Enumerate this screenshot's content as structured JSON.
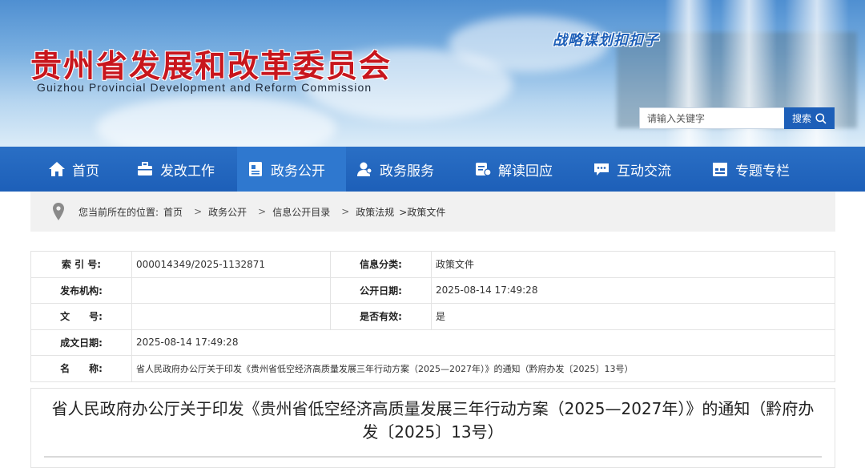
{
  "header": {
    "title_cn": "贵州省发展和改革委员会",
    "title_en": "Guizhou Provincial Development and Reform Commission",
    "slogan": "战略谋划扣扣子",
    "search": {
      "placeholder": "请输入关键字",
      "button_label": "搜索"
    }
  },
  "nav": {
    "items": [
      {
        "label": "首页",
        "icon": "home-icon"
      },
      {
        "label": "发改工作",
        "icon": "briefcase-icon"
      },
      {
        "label": "政务公开",
        "icon": "document-icon",
        "active": true
      },
      {
        "label": "政务服务",
        "icon": "user-icon"
      },
      {
        "label": "解读回应",
        "icon": "chat-doc-icon"
      },
      {
        "label": "互动交流",
        "icon": "message-icon"
      },
      {
        "label": "专题专栏",
        "icon": "calendar-icon"
      }
    ]
  },
  "breadcrumb": {
    "prefix": "您当前所在的位置:",
    "items": [
      "首页",
      "政务公开",
      "信息公开目录",
      "政策法规",
      ">政策文件"
    ]
  },
  "info": {
    "index_label": "索 引 号:",
    "index_value": "000014349/2025-1132871",
    "category_label": "信息分类:",
    "category_value": "政策文件",
    "publisher_label": "发布机构:",
    "publisher_value": "",
    "publish_date_label": "公开日期:",
    "publish_date_value": "2025-08-14 17:49:28",
    "doc_no_label": "文　　号:",
    "doc_no_value": "",
    "valid_label": "是否有效:",
    "valid_value": "是",
    "created_label": "成文日期:",
    "created_value": "2025-08-14 17:49:28",
    "name_label": "名　　称:",
    "name_value": "省人民政府办公厅关于印发《贵州省低空经济高质量发展三年行动方案（2025—2027年）》的通知（黔府办发〔2025〕13号）"
  },
  "article": {
    "title": "省人民政府办公厅关于印发《贵州省低空经济高质量发展三年行动方案（2025—2027年）》的通知（黔府办发〔2025〕13号）"
  },
  "colors": {
    "brand_blue": "#1d5fb8",
    "title_red": "#c8161d"
  }
}
